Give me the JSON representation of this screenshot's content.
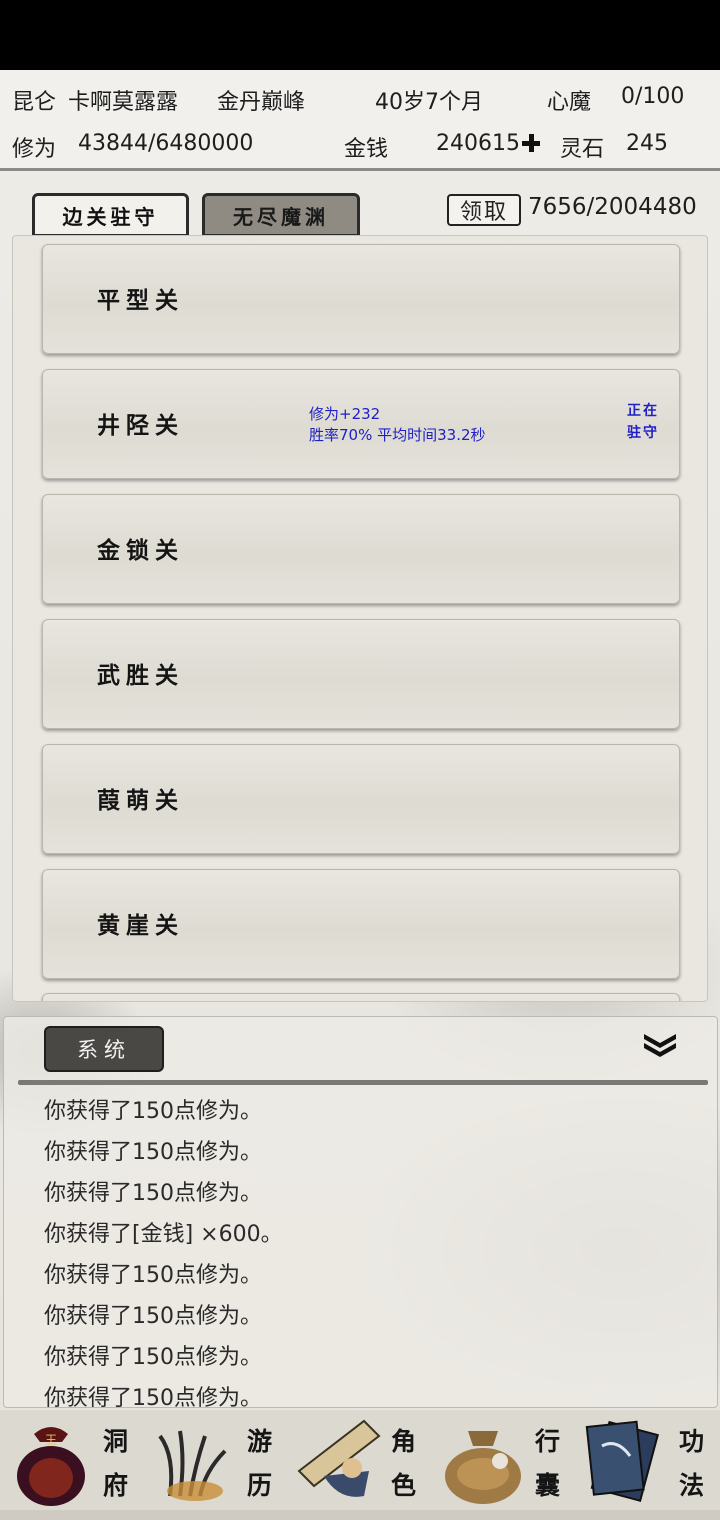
{
  "header": {
    "location": "昆仑",
    "player_name": "卡啊莫露露",
    "realm": "金丹巅峰",
    "age": "40岁7个月",
    "heart_demon_label": "心魔",
    "heart_demon_value": "0/100",
    "cultivation_label": "修为",
    "cultivation_value": "43844/6480000",
    "money_label": "金钱",
    "money_value": "240615",
    "spirit_stone_label": "灵石",
    "spirit_stone_value": "245"
  },
  "tabs": [
    {
      "label": "边关驻守",
      "active": true
    },
    {
      "label": "无尽魔渊",
      "active": false
    }
  ],
  "claim": {
    "button_label": "领取",
    "progress": "7656/2004480"
  },
  "passes": [
    {
      "name": "平型关"
    },
    {
      "name": "井陉关",
      "info_line1": "修为+232",
      "info_line2": "胜率70% 平均时间33.2秒",
      "guard_line1": "正在",
      "guard_line2": "驻守"
    },
    {
      "name": "金锁关"
    },
    {
      "name": "武胜关"
    },
    {
      "name": "葭萌关"
    },
    {
      "name": "黄崖关"
    }
  ],
  "log": {
    "tab_label": "系统",
    "lines": [
      "你获得了150点修为。",
      "你获得了150点修为。",
      "你获得了150点修为。",
      "你获得了[金钱] ×600。",
      "你获得了150点修为。",
      "你获得了150点修为。",
      "你获得了150点修为。",
      "你获得了150点修为。"
    ]
  },
  "nav": [
    {
      "char1": "洞",
      "char2": "府",
      "icon": "cave-pouch-icon"
    },
    {
      "char1": "游",
      "char2": "历",
      "icon": "grass-icon"
    },
    {
      "char1": "角",
      "char2": "色",
      "icon": "straw-hat-icon"
    },
    {
      "char1": "行",
      "char2": "囊",
      "icon": "bag-icon"
    },
    {
      "char1": "功",
      "char2": "法",
      "icon": "book-icon"
    }
  ],
  "colors": {
    "info_text": "#2020c8",
    "status_bar": "#000000"
  }
}
